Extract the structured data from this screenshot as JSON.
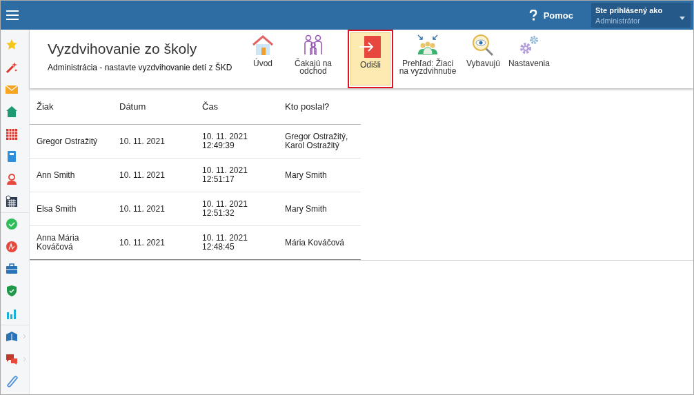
{
  "topbar": {
    "help": "Pomoc",
    "user_label": "Ste prihlásený ako",
    "user_name": "Administrátor"
  },
  "header": {
    "title": "Vyzdvihovanie zo školy",
    "subtitle": "Administrácia - nastavte vyzdvihovanie detí z ŠKD"
  },
  "toolbar": [
    {
      "label": "Úvod",
      "kind": "home",
      "selected": false
    },
    {
      "label": "Čakajú na odchod",
      "kind": "family",
      "selected": false
    },
    {
      "label": "Odišli",
      "kind": "exit",
      "selected": true
    },
    {
      "label": "Prehľad: Žiaci na vyzdvihnutie",
      "kind": "group",
      "selected": false
    },
    {
      "label": "Vybavujú",
      "kind": "eye",
      "selected": false
    },
    {
      "label": "Nastavenia",
      "kind": "gears",
      "selected": false
    }
  ],
  "table": {
    "columns": [
      "Žiak",
      "Dátum",
      "Čas",
      "Kto poslal?"
    ],
    "rows": [
      {
        "student": "Gregor Ostražitý",
        "date": "10. 11. 2021",
        "time": "10. 11. 2021 12:49:39",
        "sender": "Gregor Ostražitý, Karol Ostražitý"
      },
      {
        "student": "Ann Smith",
        "date": "10. 11. 2021",
        "time": "10. 11. 2021 12:51:17",
        "sender": "Mary Smith"
      },
      {
        "student": "Elsa Smith",
        "date": "10. 11. 2021",
        "time": "10. 11. 2021 12:51:32",
        "sender": "Mary Smith"
      },
      {
        "student": "Anna Mária Kováčová",
        "date": "10. 11. 2021",
        "time": "10. 11. 2021 12:48:45",
        "sender": "Mária Kováčová"
      }
    ]
  }
}
